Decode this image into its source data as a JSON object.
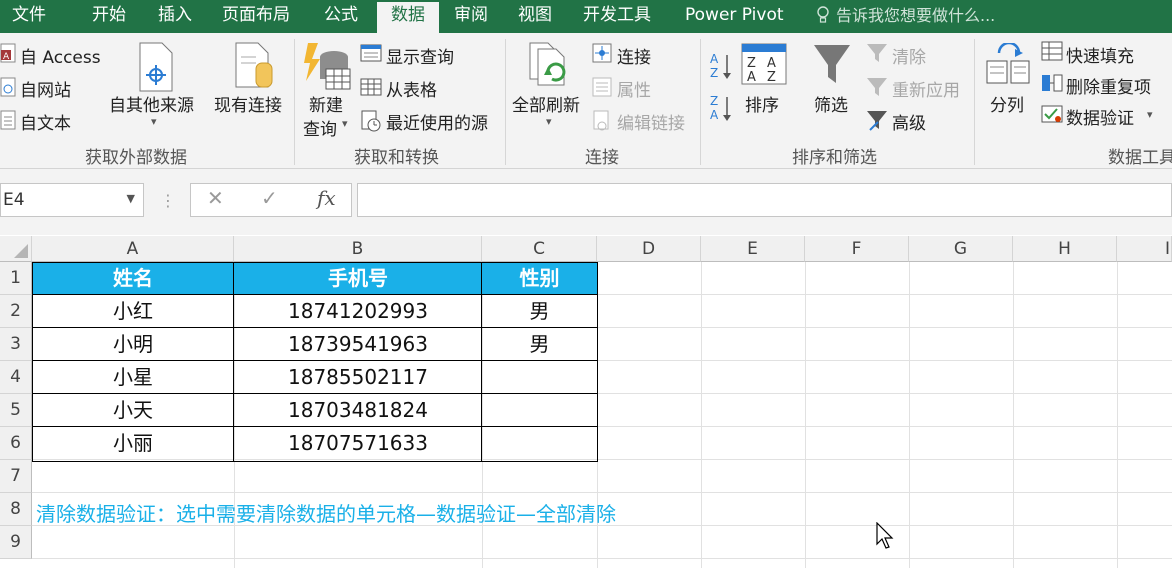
{
  "tabs": [
    {
      "label": "文件",
      "active": false
    },
    {
      "label": "开始",
      "active": false
    },
    {
      "label": "插入",
      "active": false
    },
    {
      "label": "页面布局",
      "active": false
    },
    {
      "label": "公式",
      "active": false
    },
    {
      "label": "数据",
      "active": true
    },
    {
      "label": "审阅",
      "active": false
    },
    {
      "label": "视图",
      "active": false
    },
    {
      "label": "开发工具",
      "active": false
    },
    {
      "label": "Power Pivot",
      "active": false
    }
  ],
  "tell_me": "告诉我您想要做什么...",
  "ribbon": {
    "get_external": {
      "access": "自 Access",
      "web": "自网站",
      "text": "自文本",
      "other": "自其他来源",
      "existing": "现有连接",
      "group": "获取外部数据"
    },
    "get_transform": {
      "new_query_1": "新建",
      "new_query_2": "查询",
      "show_queries": "显示查询",
      "from_table": "从表格",
      "recent_sources": "最近使用的源",
      "group": "获取和转换"
    },
    "connections": {
      "refresh_all": "全部刷新",
      "connections": "连接",
      "properties": "属性",
      "edit_links": "编辑链接",
      "group": "连接"
    },
    "sort_filter": {
      "sort": "排序",
      "filter": "筛选",
      "clear": "清除",
      "reapply": "重新应用",
      "advanced": "高级",
      "group": "排序和筛选"
    },
    "data_tools": {
      "text_to_columns": "分列",
      "flash_fill": "快速填充",
      "remove_duplicates": "删除重复项",
      "data_validation": "数据验证",
      "group": "数据工具"
    }
  },
  "formula_bar": {
    "name_box": "E4",
    "fx": "fx",
    "content": ""
  },
  "columns": [
    "A",
    "B",
    "C",
    "D",
    "E",
    "F",
    "G",
    "H",
    "I"
  ],
  "rows": [
    "1",
    "2",
    "3",
    "4",
    "5",
    "6",
    "7",
    "8",
    "9"
  ],
  "table": {
    "headers": [
      "姓名",
      "手机号",
      "性别"
    ],
    "rows": [
      [
        "小红",
        "18741202993",
        "男"
      ],
      [
        "小明",
        "18739541963",
        "男"
      ],
      [
        "小星",
        "18785502117",
        ""
      ],
      [
        "小天",
        "18703481824",
        ""
      ],
      [
        "小丽",
        "18707571633",
        ""
      ]
    ]
  },
  "note": "清除数据验证：选中需要清除数据的单元格—数据验证—全部清除",
  "colors": {
    "excel_green": "#217346",
    "header_blue": "#1ab0e8"
  }
}
